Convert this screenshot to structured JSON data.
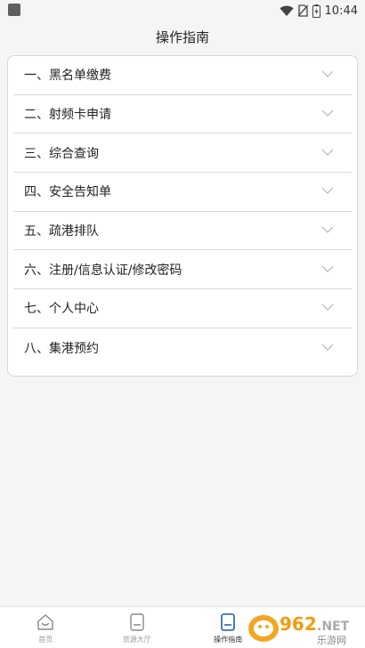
{
  "status": {
    "time": "10:44"
  },
  "header": {
    "title": "操作指南"
  },
  "guide": {
    "items": [
      {
        "label": "一、黑名单缴费"
      },
      {
        "label": "二、射频卡申请"
      },
      {
        "label": "三、综合查询"
      },
      {
        "label": "四、安全告知单"
      },
      {
        "label": "五、疏港排队"
      },
      {
        "label": "六、注册/信息认证/修改密码"
      },
      {
        "label": "七、个人中心"
      },
      {
        "label": "八、集港预约"
      }
    ]
  },
  "tabbar": {
    "tabs": [
      {
        "label": "首页",
        "icon": "home-icon"
      },
      {
        "label": "货源大厅",
        "icon": "document-icon"
      },
      {
        "label": "操作指南",
        "icon": "guide-icon",
        "active": true
      }
    ]
  },
  "watermark": {
    "text": "962.NET",
    "subtext": "乐游网"
  },
  "colors": {
    "accent": "#1e5aa8",
    "divider": "#d9d9d9",
    "background": "#f5f5f5"
  }
}
